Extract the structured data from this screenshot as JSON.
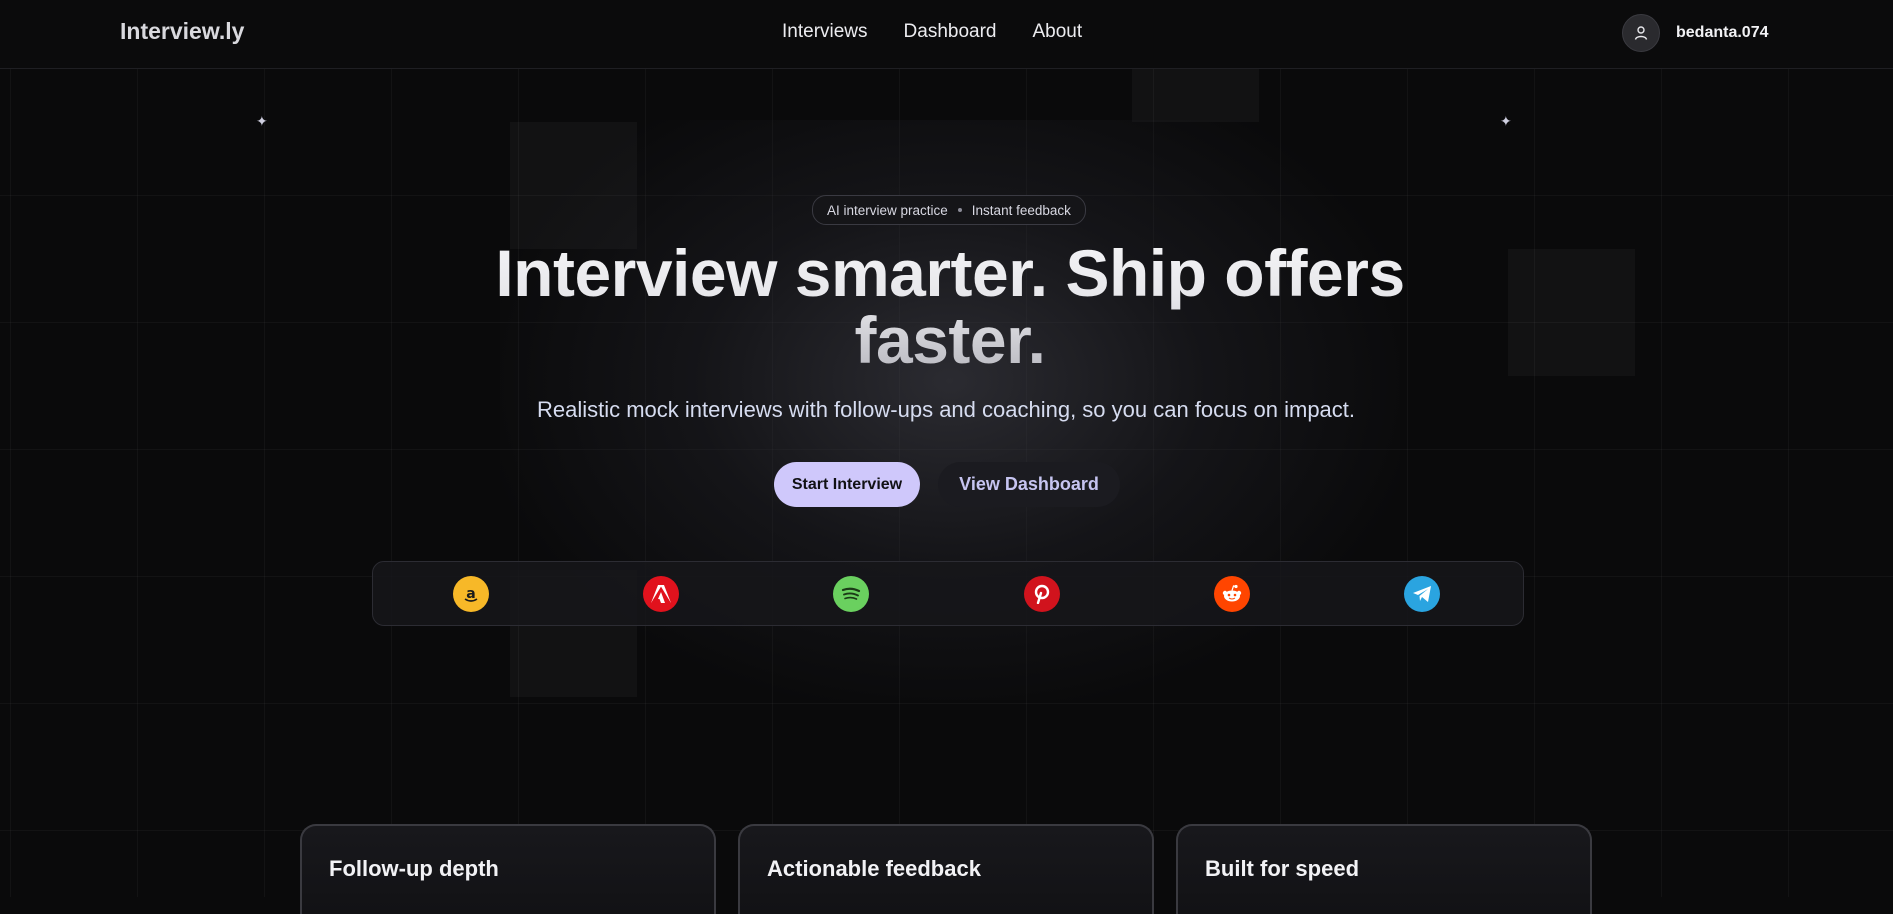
{
  "header": {
    "brand": "Interview.ly",
    "nav": [
      {
        "label": "Interviews"
      },
      {
        "label": "Dashboard"
      },
      {
        "label": "About"
      }
    ],
    "user": {
      "name": "bedanta.074",
      "icon": "user-icon"
    }
  },
  "hero": {
    "pill": {
      "left": "AI interview practice",
      "right": "Instant feedback"
    },
    "headline_line1": "Interview smarter. Ship offers",
    "headline_line2": "faster.",
    "subtitle": "Realistic mock interviews with follow-ups and coaching, so you can focus on impact.",
    "primary_button": "Start Interview",
    "secondary_button": "View Dashboard",
    "accent_color": "#cfc8fb"
  },
  "logos": [
    {
      "name": "amazon-icon",
      "color": "#f7b828"
    },
    {
      "name": "adobe-icon",
      "color": "#e1121d"
    },
    {
      "name": "spotify-icon",
      "color": "#6ad05f"
    },
    {
      "name": "pinterest-icon",
      "color": "#d1131d"
    },
    {
      "name": "reddit-icon",
      "color": "#ff4500"
    },
    {
      "name": "telegram-icon",
      "color": "#2aa4e0"
    }
  ],
  "features": [
    {
      "title": "Follow-up depth"
    },
    {
      "title": "Actionable feedback"
    },
    {
      "title": "Built for speed"
    }
  ]
}
